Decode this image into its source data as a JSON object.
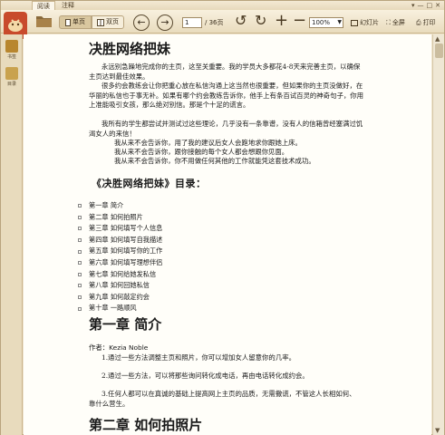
{
  "tabs": [
    "阅读",
    "注释"
  ],
  "toolbar": {
    "single_page": "单页",
    "double_page": "双页",
    "page_current": "1",
    "page_total": "/ 36页",
    "zoom": "100%",
    "slideshow": "幻灯片",
    "fullscreen": "全屏",
    "print": "打印"
  },
  "sidebar": {
    "items": [
      {
        "label": "书签"
      },
      {
        "label": "目录"
      }
    ]
  },
  "doc": {
    "title": "决胜网络把妹",
    "intro": [
      "永远别急躁地完成你的主页，这至关重要。我的学员大多都花4-8天来完善主页，以确保主页达到最佳效果。",
      "很多约会教练会让你把重心放在私信沟通上这当然也很重要，但如果你的主页没做好，在华丽的私信也于事无补。如果有哪个约会教练告诉你，他手上有条百试百灵的神奇句子，你用上准能吸引女孩，那么绝对别信。那是个十足的谎言。",
      "我所有的学生都尝试并测试过这些理论，几乎没有一条靠谱，没有人的信箱曾经塞满过饥渴女人的来信！"
    ],
    "never": [
      "我从来不会告诉你，用了我的建议后女人会跑地求你跟她上床。",
      "我从来不会告诉你，跟你接触的每个女人都会想跟你见面。",
      "我从来不会告诉你，你不用做任何其他的工作就能凭这套技术成功。"
    ],
    "toc_title": "《决胜网络把妹》目录：",
    "toc": [
      "第一章 简介",
      "第二章 如何拍照片",
      "第三章 如何填写个人信息",
      "第四章 如何填写自我描述",
      "第五章 如何填写你的工作",
      "第六章 如何填写理想伴侣",
      "第七章 如何给她发私信",
      "第八章 如何回她私信",
      "第九章 如何敲定约会",
      "第十章 一路顺风"
    ],
    "ch1_title": "第一章 简介",
    "author": "作者：Kezia Noble",
    "ch1_items": [
      "1.通过一些方法调整主页和照片，你可以增加女人留意你的几率。",
      "2.通过一些方法，可以将那些询问转化成电话，再由电话转化成约会。",
      "3.任何人都可以在真诚的基础上提高网上主页的品质，无需撒谎，不管这人长相如何、靠什么营生。"
    ],
    "ch2_title": "第二章 如何拍照片"
  },
  "colors": {
    "accent": "#c84a2c",
    "toolbar": "#efe4cc",
    "page": "#fffef9"
  }
}
